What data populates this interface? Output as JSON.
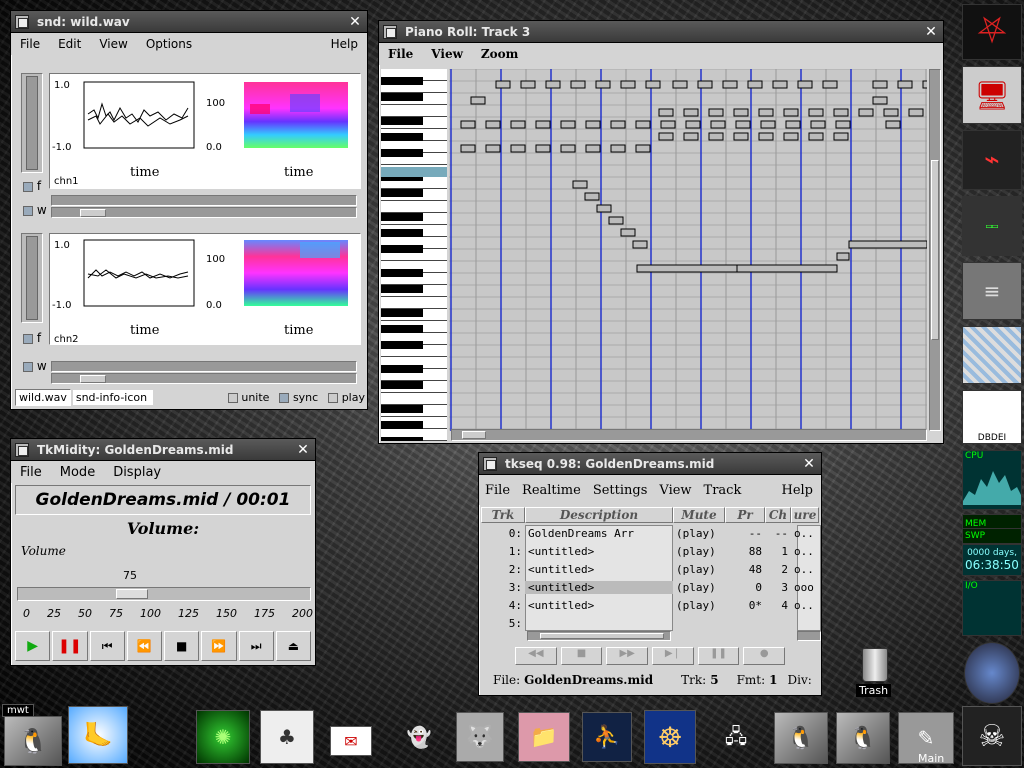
{
  "snd": {
    "title": "snd: wild.wav",
    "menu": [
      "File",
      "Edit",
      "View",
      "Options"
    ],
    "help": "Help",
    "ch1": {
      "ylab_top": "1.0",
      "ylab_bot": "-1.0",
      "spec_top": "100",
      "spec_bot": "0.0",
      "xlabel": "time",
      "name": "chn1"
    },
    "ch2": {
      "ylab_top": "1.0",
      "ylab_bot": "-1.0",
      "spec_top": "100",
      "spec_bot": "0.0",
      "xlabel": "time",
      "name": "chn2"
    },
    "f_label": "f",
    "w_label": "w",
    "bottom": {
      "file_btn": "wild.wav",
      "info": "snd-info-icon",
      "unite": "unite",
      "sync": "sync",
      "play": "play"
    }
  },
  "piano": {
    "title": "Piano Roll: Track 3",
    "menu": [
      "File",
      "View",
      "Zoom"
    ]
  },
  "tkmidity": {
    "title": "TkMidity: GoldenDreams.mid",
    "menu": [
      "File",
      "Mode",
      "Display"
    ],
    "file_time": "GoldenDreams.mid / 00:01",
    "volume_heading": "Volume:",
    "volume_label": "Volume",
    "volume_value": "75",
    "ticks": [
      "0",
      "25",
      "50",
      "75",
      "100",
      "125",
      "150",
      "175",
      "200"
    ]
  },
  "tkseq": {
    "title": "tkseq 0.98: GoldenDreams.mid",
    "menu": [
      "File",
      "Realtime",
      "Settings",
      "View",
      "Track"
    ],
    "help": "Help",
    "headers": {
      "trk": "Trk",
      "desc": "Description",
      "mute": "Mute",
      "pr": "Pr",
      "ch": "Ch",
      "ure": "ure"
    },
    "rows": [
      {
        "trk": "0:",
        "desc": "GoldenDreams Arr",
        "mute": "(play)",
        "pr": "--",
        "ch": "--",
        "ure": "o.."
      },
      {
        "trk": "1:",
        "desc": "<untitled>",
        "mute": "(play)",
        "pr": "88",
        "ch": "1",
        "ure": "o.."
      },
      {
        "trk": "2:",
        "desc": "<untitled>",
        "mute": "(play)",
        "pr": "48",
        "ch": "2",
        "ure": "o.."
      },
      {
        "trk": "3:",
        "desc": "<untitled>",
        "mute": "(play)",
        "pr": "0",
        "ch": "3",
        "ure": "ooo"
      },
      {
        "trk": "4:",
        "desc": "<untitled>",
        "mute": "(play)",
        "pr": "0*",
        "ch": "4",
        "ure": "o.."
      },
      {
        "trk": "5:",
        "desc": "",
        "mute": "",
        "pr": "",
        "ch": "",
        "ure": ""
      }
    ],
    "status": {
      "file_label": "File:",
      "file": "GoldenDreams.mid",
      "trk_label": "Trk:",
      "trk": "5",
      "fmt_label": "Fmt:",
      "fmt": "1",
      "div_label": "Div:"
    }
  },
  "desktop": {
    "trash": "Trash",
    "mwt": "mwt",
    "main": "Main",
    "cpu": "CPU",
    "mem": "MEM",
    "swp": "SWP",
    "days": "0000 days,",
    "clock": "06:38:50",
    "io": "I/O",
    "label_dbdei": "DBDEI"
  }
}
